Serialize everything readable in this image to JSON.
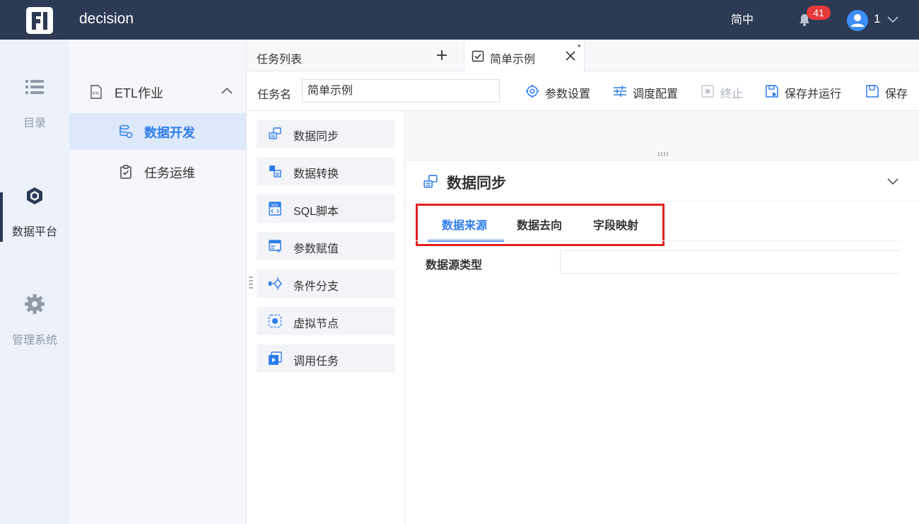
{
  "topbar": {
    "app_title": "decision",
    "language": "简中",
    "notification_count": "41",
    "user_name": "1",
    "colors": {
      "bar": "#2c3a54",
      "badge": "#e5383b",
      "avatar": "#3d8ef7"
    }
  },
  "leftnav": {
    "items": [
      {
        "label": "目录",
        "icon": "list-icon",
        "active": false
      },
      {
        "label": "数据平台",
        "icon": "cube-icon",
        "active": true
      },
      {
        "label": "管理系统",
        "icon": "gear-icon",
        "active": false
      }
    ]
  },
  "subnav": {
    "group": {
      "label": "ETL作业",
      "icon": "etl-file-icon",
      "expanded": true
    },
    "items": [
      {
        "label": "数据开发",
        "icon": "database-gear-icon",
        "active": true
      },
      {
        "label": "任务运维",
        "icon": "clipboard-check-icon",
        "active": false
      }
    ]
  },
  "tabs": {
    "list_label": "任务列表",
    "doc_label": "简单示例",
    "doc_dirty_marker": "*"
  },
  "toolbar": {
    "name_label": "任务名",
    "name_value": "简单示例",
    "buttons": [
      {
        "label": "参数设置",
        "icon": "settings-icon",
        "enabled": true
      },
      {
        "label": "调度配置",
        "icon": "sliders-icon",
        "enabled": true
      },
      {
        "label": "终止",
        "icon": "stop-icon",
        "enabled": false
      },
      {
        "label": "保存并运行",
        "icon": "save-run-icon",
        "enabled": true
      },
      {
        "label": "保存",
        "icon": "save-icon",
        "enabled": true
      }
    ]
  },
  "palette": {
    "nodes": [
      {
        "label": "数据同步",
        "icon": "data-sync-icon"
      },
      {
        "label": "数据转换",
        "icon": "data-transform-icon"
      },
      {
        "label": "SQL脚本",
        "icon": "sql-script-icon"
      },
      {
        "label": "参数赋值",
        "icon": "param-assign-icon"
      },
      {
        "label": "条件分支",
        "icon": "branch-icon"
      },
      {
        "label": "虚拟节点",
        "icon": "virtual-node-icon"
      },
      {
        "label": "调用任务",
        "icon": "call-task-icon"
      }
    ]
  },
  "panel": {
    "title": "数据同步",
    "tabs": [
      {
        "label": "数据来源",
        "active": true
      },
      {
        "label": "数据去向",
        "active": false
      },
      {
        "label": "字段映射",
        "active": false
      }
    ],
    "field_label": "数据源类型",
    "field_value": "",
    "accent": "#2f7dea",
    "highlight_box": "#e02020"
  }
}
